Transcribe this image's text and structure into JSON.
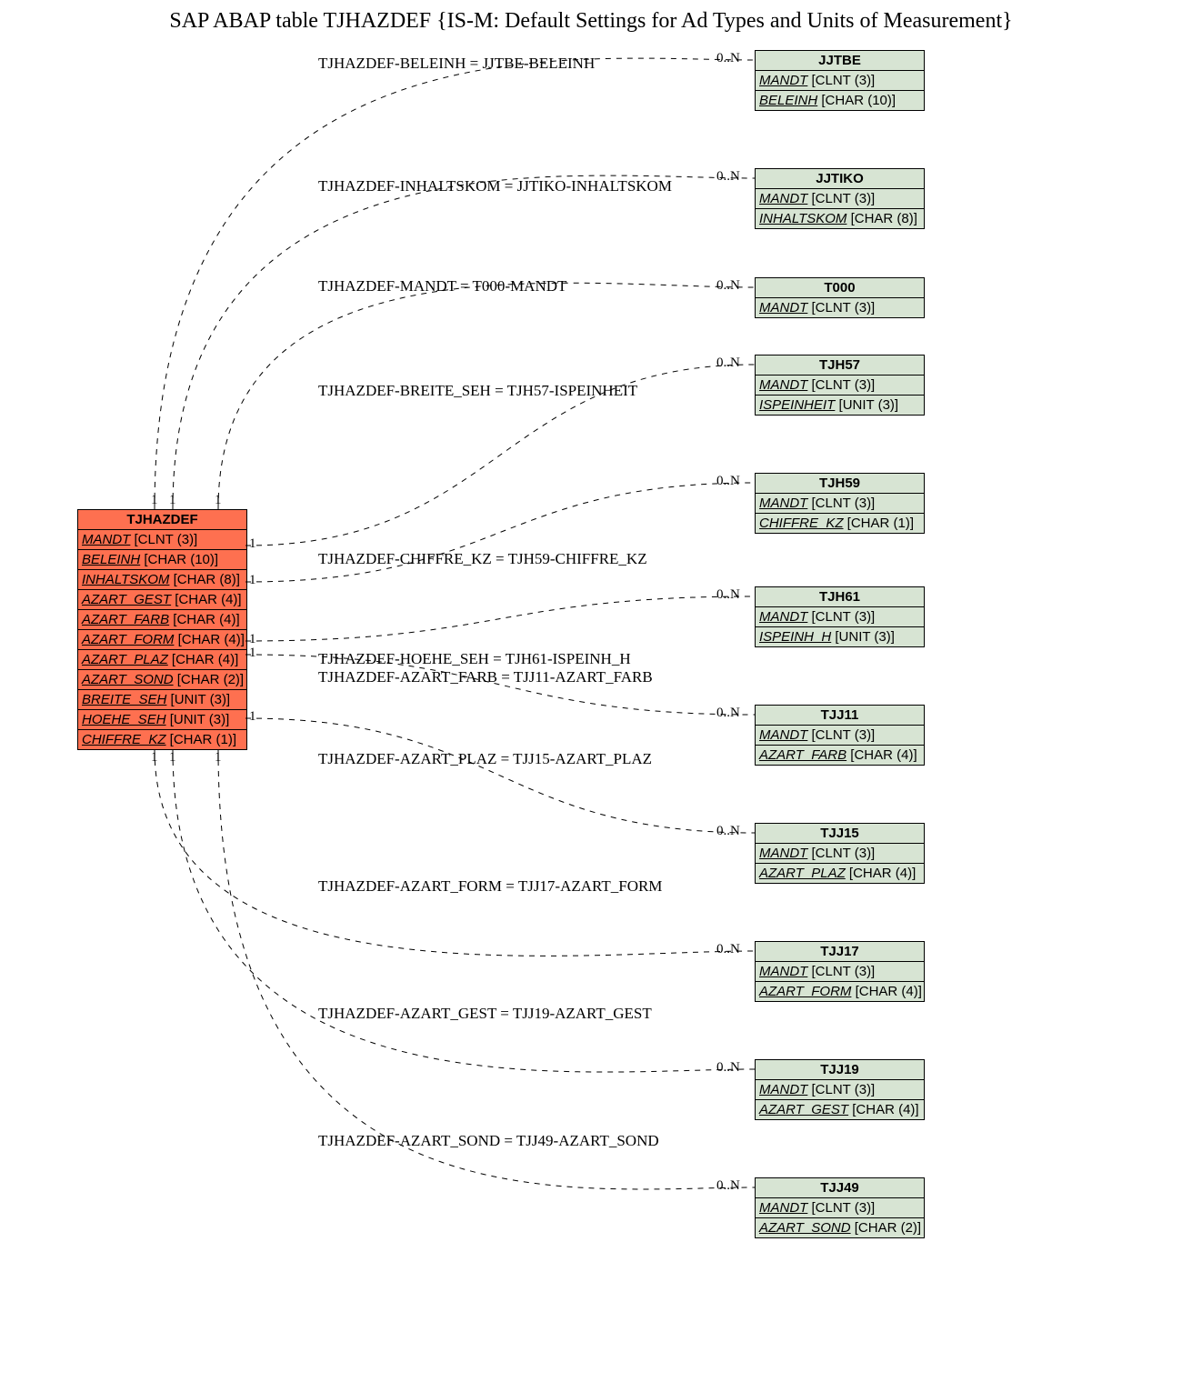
{
  "title": "SAP ABAP table TJHAZDEF {IS-M: Default Settings for Ad Types and Units of Measurement}",
  "main": {
    "name": "TJHAZDEF",
    "fields": [
      {
        "n": "MANDT",
        "t": "[CLNT (3)]"
      },
      {
        "n": "BELEINH",
        "t": "[CHAR (10)]"
      },
      {
        "n": "INHALTSKOM",
        "t": "[CHAR (8)]"
      },
      {
        "n": "AZART_GEST",
        "t": "[CHAR (4)]"
      },
      {
        "n": "AZART_FARB",
        "t": "[CHAR (4)]"
      },
      {
        "n": "AZART_FORM",
        "t": "[CHAR (4)]"
      },
      {
        "n": "AZART_PLAZ",
        "t": "[CHAR (4)]"
      },
      {
        "n": "AZART_SOND",
        "t": "[CHAR (2)]"
      },
      {
        "n": "BREITE_SEH",
        "t": "[UNIT (3)]"
      },
      {
        "n": "HOEHE_SEH",
        "t": "[UNIT (3)]"
      },
      {
        "n": "CHIFFRE_KZ",
        "t": "[CHAR (1)]"
      }
    ]
  },
  "related": [
    {
      "name": "JJTBE",
      "fields": [
        {
          "n": "MANDT",
          "t": "[CLNT (3)]"
        },
        {
          "n": "BELEINH",
          "t": "[CHAR (10)]"
        }
      ]
    },
    {
      "name": "JJTIKO",
      "fields": [
        {
          "n": "MANDT",
          "t": "[CLNT (3)]"
        },
        {
          "n": "INHALTSKOM",
          "t": "[CHAR (8)]"
        }
      ]
    },
    {
      "name": "T000",
      "fields": [
        {
          "n": "MANDT",
          "t": "[CLNT (3)]"
        }
      ]
    },
    {
      "name": "TJH57",
      "fields": [
        {
          "n": "MANDT",
          "t": "[CLNT (3)]"
        },
        {
          "n": "ISPEINHEIT",
          "t": "[UNIT (3)]"
        }
      ]
    },
    {
      "name": "TJH59",
      "fields": [
        {
          "n": "MANDT",
          "t": "[CLNT (3)]"
        },
        {
          "n": "CHIFFRE_KZ",
          "t": "[CHAR (1)]"
        }
      ]
    },
    {
      "name": "TJH61",
      "fields": [
        {
          "n": "MANDT",
          "t": "[CLNT (3)]"
        },
        {
          "n": "ISPEINH_H",
          "t": "[UNIT (3)]"
        }
      ]
    },
    {
      "name": "TJJ11",
      "fields": [
        {
          "n": "MANDT",
          "t": "[CLNT (3)]"
        },
        {
          "n": "AZART_FARB",
          "t": "[CHAR (4)]"
        }
      ]
    },
    {
      "name": "TJJ15",
      "fields": [
        {
          "n": "MANDT",
          "t": "[CLNT (3)]"
        },
        {
          "n": "AZART_PLAZ",
          "t": "[CHAR (4)]"
        }
      ]
    },
    {
      "name": "TJJ17",
      "fields": [
        {
          "n": "MANDT",
          "t": "[CLNT (3)]"
        },
        {
          "n": "AZART_FORM",
          "t": "[CHAR (4)]"
        }
      ]
    },
    {
      "name": "TJJ19",
      "fields": [
        {
          "n": "MANDT",
          "t": "[CLNT (3)]"
        },
        {
          "n": "AZART_GEST",
          "t": "[CHAR (4)]"
        }
      ]
    },
    {
      "name": "TJJ49",
      "fields": [
        {
          "n": "MANDT",
          "t": "[CLNT (3)]"
        },
        {
          "n": "AZART_SOND",
          "t": "[CHAR (2)]"
        }
      ]
    }
  ],
  "labels": [
    "TJHAZDEF-BELEINH = JJTBE-BELEINH",
    "TJHAZDEF-INHALTSKOM = JJTIKO-INHALTSKOM",
    "TJHAZDEF-MANDT = T000-MANDT",
    "TJHAZDEF-BREITE_SEH = TJH57-ISPEINHEIT",
    "TJHAZDEF-CHIFFRE_KZ = TJH59-CHIFFRE_KZ",
    "TJHAZDEF-HOEHE_SEH = TJH61-ISPEINH_H",
    "TJHAZDEF-AZART_FARB = TJJ11-AZART_FARB",
    "TJHAZDEF-AZART_PLAZ = TJJ15-AZART_PLAZ",
    "TJHAZDEF-AZART_FORM = TJJ17-AZART_FORM",
    "TJHAZDEF-AZART_GEST = TJJ19-AZART_GEST",
    "TJHAZDEF-AZART_SOND = TJJ49-AZART_SOND"
  ],
  "leftCard": "1",
  "rightCard": "0..N"
}
